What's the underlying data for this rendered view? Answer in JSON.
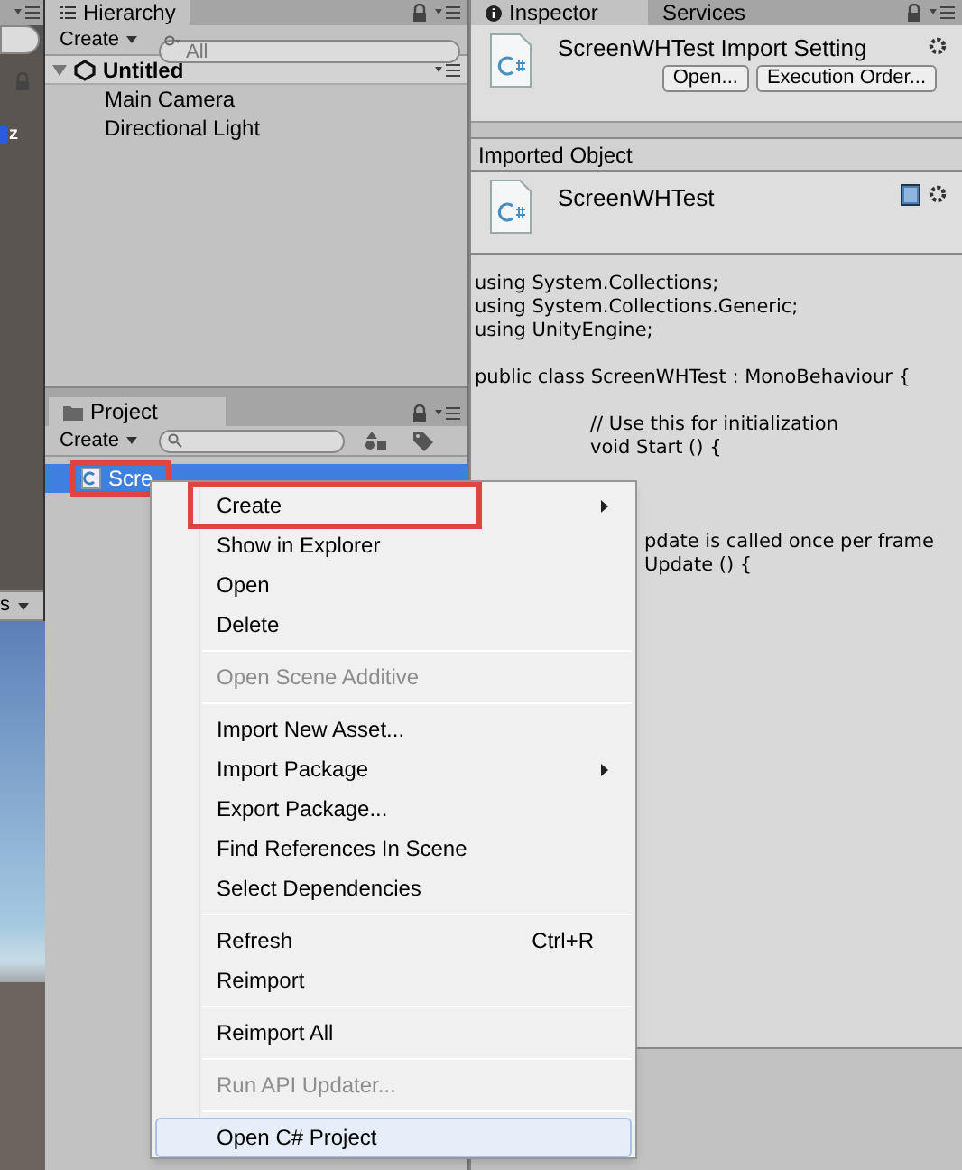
{
  "scene_view": {
    "axis_label": "z",
    "bottom_label": "s"
  },
  "hierarchy": {
    "tab": "Hierarchy",
    "create": "Create",
    "search": {
      "placeholder": "All"
    },
    "scene": {
      "name": "Untitled",
      "expanded": true,
      "children": [
        {
          "name": "Main Camera"
        },
        {
          "name": "Directional Light"
        }
      ]
    }
  },
  "project": {
    "tab": "Project",
    "create": "Create",
    "assets": [
      {
        "name": "Scre",
        "selected": true,
        "annotated": true
      }
    ]
  },
  "inspector": {
    "tabs": [
      {
        "label": "Inspector",
        "selected": true
      },
      {
        "label": "Services",
        "selected": false
      }
    ],
    "title": "ScreenWHTest Import Setting",
    "buttons": [
      "Open...",
      "Execution Order..."
    ],
    "section": "Imported Object",
    "object_name": "ScreenWHTest",
    "code": [
      {
        "kind": "top",
        "text": "using System.Collections;"
      },
      {
        "kind": "top",
        "text": "using System.Collections.Generic;"
      },
      {
        "kind": "top",
        "text": "using UnityEngine;"
      },
      {
        "kind": "blank"
      },
      {
        "kind": "top",
        "text": "public class ScreenWHTest : MonoBehaviour {"
      },
      {
        "kind": "blank"
      },
      {
        "kind": "member",
        "text": "// Use this for initialization"
      },
      {
        "kind": "member",
        "text": "void Start () {"
      },
      {
        "kind": "blank"
      },
      {
        "kind": "blank"
      },
      {
        "kind": "blank"
      },
      {
        "kind": "clipped",
        "text": "pdate is called once per frame"
      },
      {
        "kind": "clipped",
        "text": "Update () {"
      }
    ]
  },
  "context_menu": {
    "groups": [
      {
        "items": [
          {
            "label": "Create",
            "submenu": true,
            "disabled": false,
            "selected": false,
            "annotated": true
          },
          {
            "label": "Show in Explorer",
            "submenu": false,
            "disabled": false,
            "selected": false,
            "annotated": false
          },
          {
            "label": "Open",
            "submenu": false,
            "disabled": false,
            "selected": false,
            "annotated": false
          },
          {
            "label": "Delete",
            "submenu": false,
            "disabled": false,
            "selected": false,
            "annotated": false
          }
        ]
      },
      {
        "items": [
          {
            "label": "Open Scene Additive",
            "submenu": false,
            "disabled": true,
            "selected": false,
            "annotated": false
          }
        ]
      },
      {
        "items": [
          {
            "label": "Import New Asset...",
            "submenu": false,
            "disabled": false,
            "selected": false,
            "annotated": false
          },
          {
            "label": "Import Package",
            "submenu": true,
            "disabled": false,
            "selected": false,
            "annotated": false
          },
          {
            "label": "Export Package...",
            "submenu": false,
            "disabled": false,
            "selected": false,
            "annotated": false
          },
          {
            "label": "Find References In Scene",
            "submenu": false,
            "disabled": false,
            "selected": false,
            "annotated": false
          },
          {
            "label": "Select Dependencies",
            "submenu": false,
            "disabled": false,
            "selected": false,
            "annotated": false
          }
        ]
      },
      {
        "items": [
          {
            "label": "Refresh",
            "shortcut": "Ctrl+R",
            "submenu": false,
            "disabled": false,
            "selected": false,
            "annotated": false
          },
          {
            "label": "Reimport",
            "submenu": false,
            "disabled": false,
            "selected": false,
            "annotated": false
          }
        ]
      },
      {
        "items": [
          {
            "label": "Reimport All",
            "submenu": false,
            "disabled": false,
            "selected": false,
            "annotated": false
          }
        ]
      },
      {
        "items": [
          {
            "label": "Run API Updater...",
            "submenu": false,
            "disabled": true,
            "selected": false,
            "annotated": false
          }
        ]
      },
      {
        "items": [
          {
            "label": "Open C# Project",
            "submenu": false,
            "disabled": false,
            "selected": true,
            "annotated": false
          }
        ]
      }
    ]
  }
}
